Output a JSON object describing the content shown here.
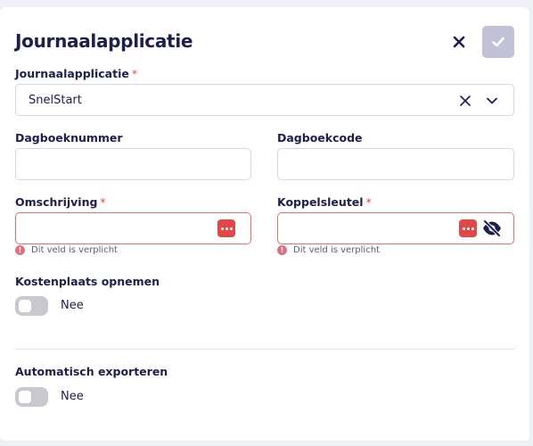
{
  "header": {
    "title": "Journaalapplicatie"
  },
  "icons": {
    "close": "close-icon",
    "save": "check-icon",
    "clear": "clear-icon",
    "chevron": "chevron-down-icon",
    "dots": "password-dots-icon",
    "eye": "eye-slash-icon",
    "error": "error-icon"
  },
  "colors": {
    "primary": "#1d1d4f",
    "required": "#e04848",
    "error_border": "#e0707a",
    "save_disabled": "#c3c1d8",
    "toggle_off": "#c9c7cf"
  },
  "fields": {
    "app": {
      "label": "Journaalapplicatie",
      "required": "*",
      "value": "SnelStart"
    },
    "dagboeknummer": {
      "label": "Dagboeknummer",
      "value": ""
    },
    "dagboekcode": {
      "label": "Dagboekcode",
      "value": ""
    },
    "omschrijving": {
      "label": "Omschrijving",
      "required": "*",
      "value": "",
      "error": "Dit veld is verplicht"
    },
    "koppelsleutel": {
      "label": "Koppelsleutel",
      "required": "*",
      "value": "",
      "error": "Dit veld is verplicht"
    }
  },
  "toggles": {
    "kostenplaats": {
      "label": "Kostenplaats opnemen",
      "state": "Nee"
    },
    "export": {
      "label": "Automatisch exporteren",
      "state": "Nee"
    }
  }
}
